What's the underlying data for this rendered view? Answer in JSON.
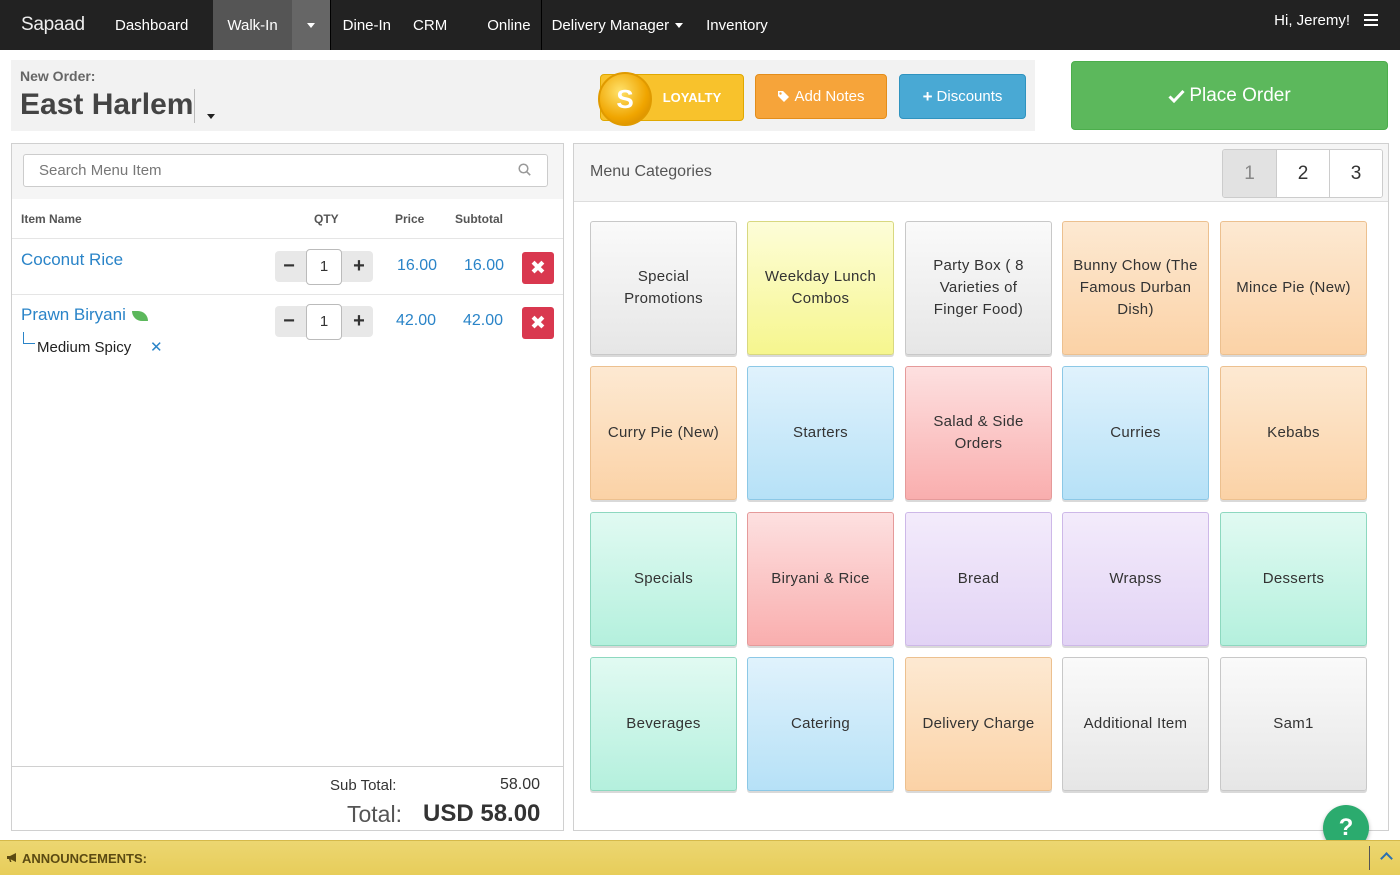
{
  "nav": {
    "brand": "Sapaad",
    "items": [
      "Dashboard",
      "Walk-In",
      "Dine-In",
      "CRM",
      "Online",
      "Delivery Manager",
      "Inventory"
    ],
    "greeting": "Hi, Jeremy!"
  },
  "order": {
    "label": "New Order:",
    "location": "East Harlem"
  },
  "buttons": {
    "loyalty": "LOYALTY",
    "coin_letter": "S",
    "notes": "Add Notes",
    "discounts": "Discounts",
    "place_order": "Place Order"
  },
  "search": {
    "placeholder": "Search Menu Item"
  },
  "columns": {
    "name": "Item Name",
    "qty": "QTY",
    "price": "Price",
    "subtotal": "Subtotal"
  },
  "items": [
    {
      "name": "Coconut Rice",
      "qty": "1",
      "price": "16.00",
      "subtotal": "16.00"
    },
    {
      "name": "Prawn Biryani",
      "qty": "1",
      "price": "42.00",
      "subtotal": "42.00",
      "modifier": "Medium Spicy"
    }
  ],
  "totals": {
    "sub_label": "Sub Total:",
    "sub_value": "58.00",
    "total_label": "Total:",
    "total_value": "USD 58.00"
  },
  "menu": {
    "title": "Menu Categories",
    "pages": [
      "1",
      "2",
      "3"
    ],
    "categories": [
      {
        "name": "Special Promotions",
        "color": "#e6e6e6"
      },
      {
        "name": "Weekday Lunch Combos",
        "color": "#f6f68e"
      },
      {
        "name": "Party Box ( 8 Varieties of Finger Food)",
        "color": "#e6e6e6"
      },
      {
        "name": "Bunny Chow (The Famous Durban Dish)",
        "color": "#fbd2a6"
      },
      {
        "name": "Mince Pie (New)",
        "color": "#fbd2a6"
      },
      {
        "name": "Curry Pie (New)",
        "color": "#fbd2a6"
      },
      {
        "name": "Starters",
        "color": "#b6e1f7"
      },
      {
        "name": "Salad & Side Orders",
        "color": "#f9aeae"
      },
      {
        "name": "Curries",
        "color": "#b6e1f7"
      },
      {
        "name": "Kebabs",
        "color": "#fbd2a6"
      },
      {
        "name": "Specials",
        "color": "#b4f0dd"
      },
      {
        "name": "Biryani & Rice",
        "color": "#f9aeae"
      },
      {
        "name": "Bread",
        "color": "#e2d3f5"
      },
      {
        "name": "Wrapss",
        "color": "#e2d3f5"
      },
      {
        "name": "Desserts",
        "color": "#b4f0dd"
      },
      {
        "name": "Beverages",
        "color": "#b4f0dd"
      },
      {
        "name": "Catering",
        "color": "#b6e1f7"
      },
      {
        "name": "Delivery Charge",
        "color": "#fbd2a6"
      },
      {
        "name": "Additional Item",
        "color": "#e6e6e6"
      },
      {
        "name": "Sam1",
        "color": "#e6e6e6"
      }
    ]
  },
  "help": "?",
  "announcements": "ANNOUNCEMENTS:"
}
